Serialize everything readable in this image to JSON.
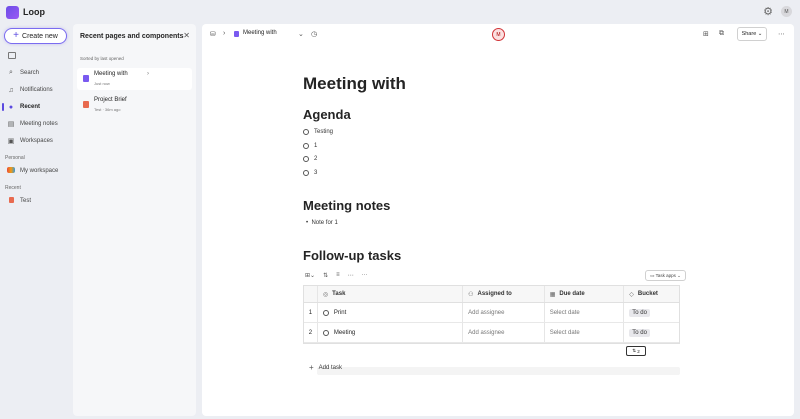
{
  "app": {
    "name": "Loop"
  },
  "nav": {
    "create_label": "Create new",
    "items": [
      {
        "label": "Search"
      },
      {
        "label": "Notifications"
      },
      {
        "label": "Recent"
      },
      {
        "label": "Meeting notes"
      },
      {
        "label": "Workspaces"
      }
    ],
    "personal_heading": "Personal",
    "workspace_label": "My workspace",
    "recent_heading": "Recent",
    "recent_item": "Test"
  },
  "recent_panel": {
    "title": "Recent pages and components",
    "sort_label": "Sorted by last opened",
    "items": [
      {
        "title": "Meeting with",
        "sub": "Just now"
      },
      {
        "title": "Project Brief",
        "sub": "Test · 36m ago"
      }
    ]
  },
  "header": {
    "page_name": "Meeting with",
    "avatar_initials": "M",
    "share_label": "Share"
  },
  "document": {
    "title": "Meeting with",
    "agenda_heading": "Agenda",
    "agenda_items": [
      "Testing",
      "1",
      "2",
      "3"
    ],
    "notes_heading": "Meeting notes",
    "notes_bullet": "Note for 1",
    "tasks_heading": "Follow-up tasks",
    "task_apps_label": "Task apps",
    "columns": {
      "task": "Task",
      "assigned": "Assigned to",
      "due": "Due date",
      "bucket": "Bucket"
    },
    "rows": [
      {
        "num": "1",
        "task": "Print",
        "assignee": "Add assignee",
        "due": "Select date",
        "bucket": "To do"
      },
      {
        "num": "2",
        "task": "Meeting",
        "assignee": "Add assignee",
        "due": "Select date",
        "bucket": "To do"
      }
    ],
    "pager_label": "2",
    "add_task_label": "Add task"
  }
}
